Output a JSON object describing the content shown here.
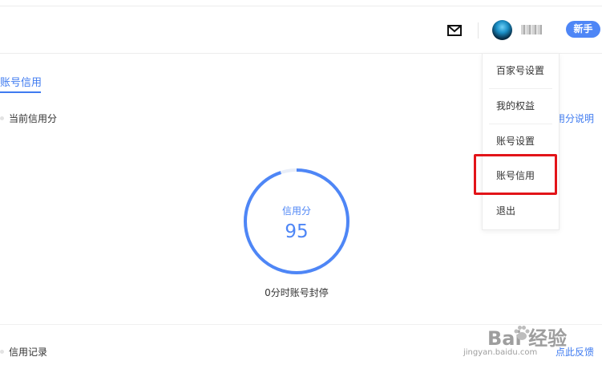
{
  "header": {
    "username": "",
    "newbie_button": "新手"
  },
  "dropdown": {
    "items": [
      {
        "label": "百家号设置"
      },
      {
        "label": "我的权益"
      },
      {
        "label": "账号设置"
      },
      {
        "label": "账号信用"
      },
      {
        "label": "退出"
      }
    ]
  },
  "tab": {
    "active_label": "账号信用"
  },
  "credit": {
    "section_title": "当前信用分",
    "help_link": "用分说明",
    "score_label": "信用分",
    "score": "95",
    "score_progress": 0.95,
    "caption": "0分时账号封停"
  },
  "records": {
    "section_title": "信用记录",
    "feedback_link": "点此反馈"
  },
  "watermark": {
    "logo_text": "Bai  经验",
    "url": "jingyan.baidu.com"
  },
  "colors": {
    "accent": "#4e86f6",
    "highlight": "#e21419"
  }
}
